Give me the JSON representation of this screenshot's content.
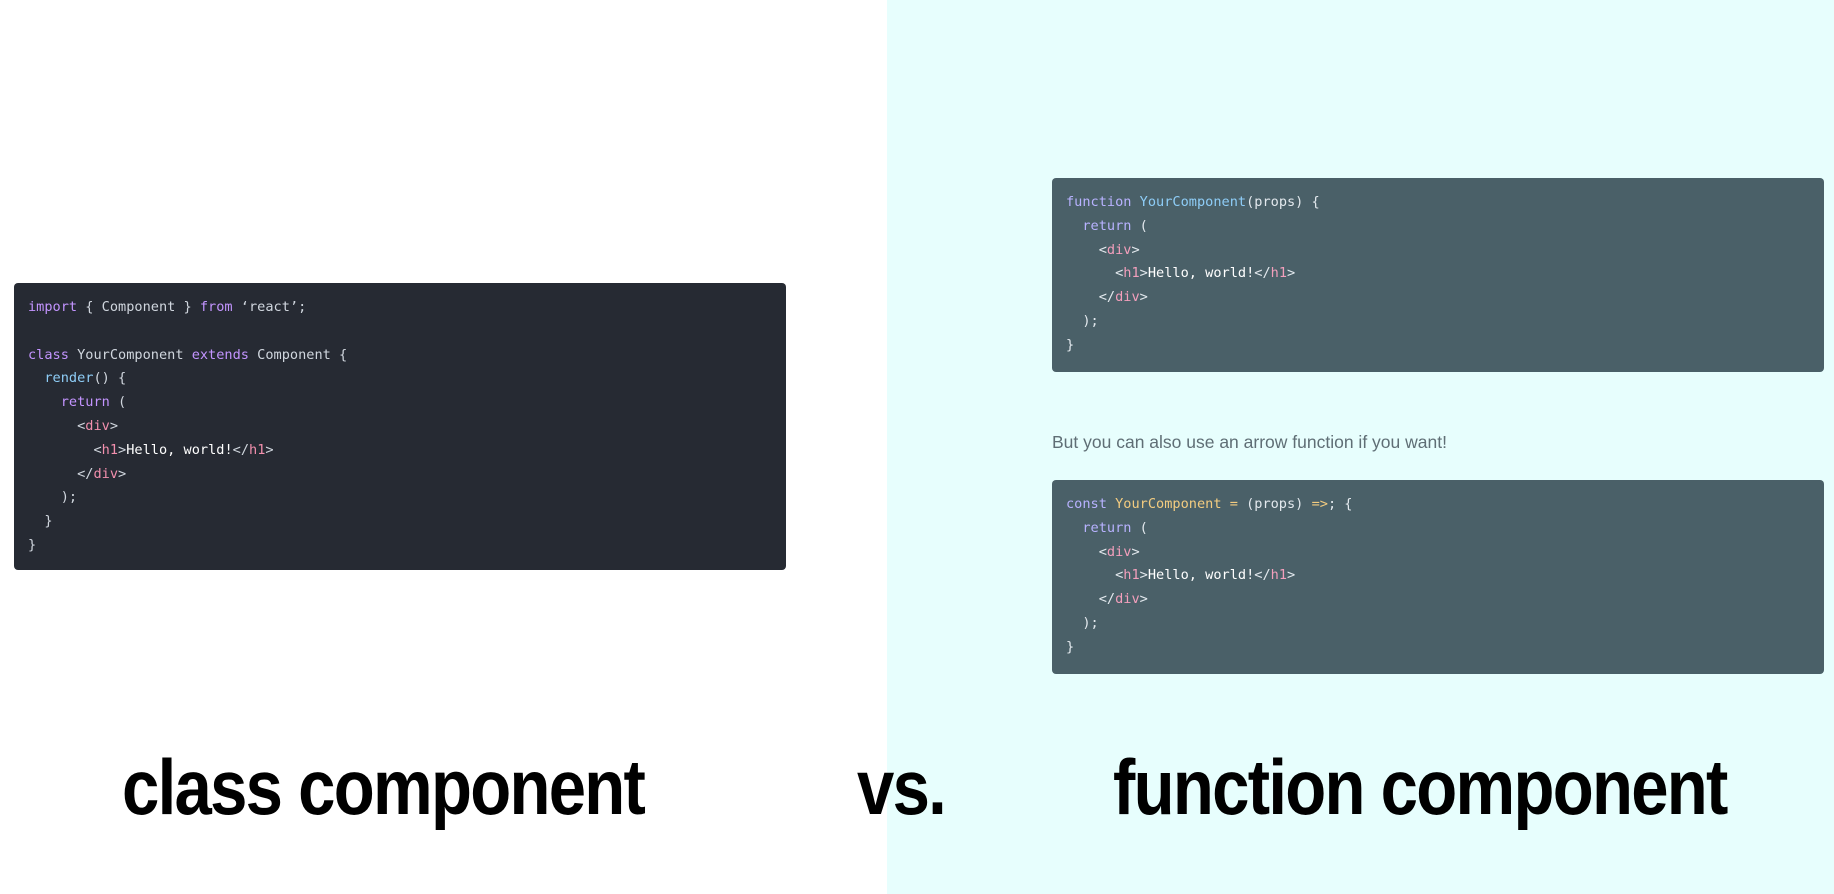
{
  "class_code": {
    "lines": [
      [
        {
          "t": "import",
          "c": "keyword"
        },
        {
          "t": " { Component } ",
          "c": "plain"
        },
        {
          "t": "from",
          "c": "keyword"
        },
        {
          "t": " ‘react’;",
          "c": "string"
        }
      ],
      [],
      [
        {
          "t": "class",
          "c": "keyword"
        },
        {
          "t": " YourComponent ",
          "c": "plain"
        },
        {
          "t": "extends",
          "c": "keyword"
        },
        {
          "t": " Component {",
          "c": "plain"
        }
      ],
      [
        {
          "t": "  ",
          "c": "plain"
        },
        {
          "t": "render",
          "c": "func"
        },
        {
          "t": "() {",
          "c": "plain"
        }
      ],
      [
        {
          "t": "    ",
          "c": "plain"
        },
        {
          "t": "return",
          "c": "keyword"
        },
        {
          "t": " (",
          "c": "plain"
        }
      ],
      [
        {
          "t": "      <",
          "c": "plain"
        },
        {
          "t": "div",
          "c": "tag"
        },
        {
          "t": ">",
          "c": "plain"
        }
      ],
      [
        {
          "t": "        <",
          "c": "plain"
        },
        {
          "t": "h1",
          "c": "tag"
        },
        {
          "t": ">",
          "c": "plain"
        },
        {
          "t": "Hello, world!",
          "c": "text"
        },
        {
          "t": "</",
          "c": "plain"
        },
        {
          "t": "h1",
          "c": "tag"
        },
        {
          "t": ">",
          "c": "plain"
        }
      ],
      [
        {
          "t": "      </",
          "c": "plain"
        },
        {
          "t": "div",
          "c": "tag"
        },
        {
          "t": ">",
          "c": "plain"
        }
      ],
      [
        {
          "t": "    );",
          "c": "plain"
        }
      ],
      [
        {
          "t": "  }",
          "c": "plain"
        }
      ],
      [
        {
          "t": "}",
          "c": "plain"
        }
      ]
    ]
  },
  "function_code": {
    "lines": [
      [
        {
          "t": "function",
          "c": "keyword"
        },
        {
          "t": " ",
          "c": "plain"
        },
        {
          "t": "YourComponent",
          "c": "func"
        },
        {
          "t": "(props) {",
          "c": "plain"
        }
      ],
      [
        {
          "t": "  ",
          "c": "plain"
        },
        {
          "t": "return",
          "c": "keyword"
        },
        {
          "t": " (",
          "c": "plain"
        }
      ],
      [
        {
          "t": "    <",
          "c": "plain"
        },
        {
          "t": "div",
          "c": "tag"
        },
        {
          "t": ">",
          "c": "plain"
        }
      ],
      [
        {
          "t": "      <",
          "c": "plain"
        },
        {
          "t": "h1",
          "c": "tag"
        },
        {
          "t": ">",
          "c": "plain"
        },
        {
          "t": "Hello, world!",
          "c": "text"
        },
        {
          "t": "</",
          "c": "plain"
        },
        {
          "t": "h1",
          "c": "tag"
        },
        {
          "t": ">",
          "c": "plain"
        }
      ],
      [
        {
          "t": "    </",
          "c": "plain"
        },
        {
          "t": "div",
          "c": "tag"
        },
        {
          "t": ">",
          "c": "plain"
        }
      ],
      [
        {
          "t": "  );",
          "c": "plain"
        }
      ],
      [
        {
          "t": "}",
          "c": "plain"
        }
      ]
    ]
  },
  "prose_text": "But you can also use an arrow function if you want!",
  "arrow_code": {
    "lines": [
      [
        {
          "t": "const",
          "c": "keyword"
        },
        {
          "t": " ",
          "c": "plain"
        },
        {
          "t": "YourComponent",
          "c": "const-name"
        },
        {
          "t": " ",
          "c": "plain"
        },
        {
          "t": "=",
          "c": "op"
        },
        {
          "t": " (props) ",
          "c": "plain"
        },
        {
          "t": "=>",
          "c": "op"
        },
        {
          "t": "; {",
          "c": "plain"
        }
      ],
      [
        {
          "t": "  ",
          "c": "plain"
        },
        {
          "t": "return",
          "c": "keyword"
        },
        {
          "t": " (",
          "c": "plain"
        }
      ],
      [
        {
          "t": "    <",
          "c": "plain"
        },
        {
          "t": "div",
          "c": "tag"
        },
        {
          "t": ">",
          "c": "plain"
        }
      ],
      [
        {
          "t": "      <",
          "c": "plain"
        },
        {
          "t": "h1",
          "c": "tag"
        },
        {
          "t": ">",
          "c": "plain"
        },
        {
          "t": "Hello, world!",
          "c": "text"
        },
        {
          "t": "</",
          "c": "plain"
        },
        {
          "t": "h1",
          "c": "tag"
        },
        {
          "t": ">",
          "c": "plain"
        }
      ],
      [
        {
          "t": "    </",
          "c": "plain"
        },
        {
          "t": "div",
          "c": "tag"
        },
        {
          "t": ">",
          "c": "plain"
        }
      ],
      [
        {
          "t": "  );",
          "c": "plain"
        }
      ],
      [
        {
          "t": "}",
          "c": "plain"
        }
      ]
    ]
  },
  "titles": {
    "left": "class component",
    "middle": "vs.",
    "right": "function component"
  },
  "colors": {
    "left_background": "#ffffff",
    "right_background": "#e7fefd",
    "class_code_background": "#262a33",
    "function_code_background": "#4a6068",
    "keyword": "#c394ff",
    "tag": "#f28fad",
    "function_name": "#8ecdf7",
    "const_name": "#f3cc80"
  }
}
